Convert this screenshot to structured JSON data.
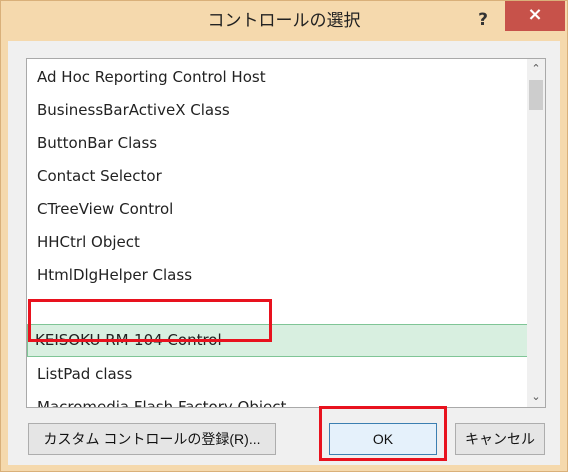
{
  "window": {
    "title": "コントロールの選択",
    "help_label": "?",
    "close_label": "×"
  },
  "list": {
    "items": [
      "Ad Hoc Reporting Control Host",
      "BusinessBarActiveX Class",
      "ButtonBar Class",
      "Contact Selector",
      "CTreeView Control",
      "HHCtrl Object",
      "HtmlDlgHelper Class",
      "KEISOKU RM-104 Control",
      "ListPad class",
      "Macromedia Flash Factory Object"
    ],
    "selected_item": "KEISOKU RM-104 Control"
  },
  "scrollbar": {
    "up_icon": "chevron-up-icon",
    "down_icon": "chevron-down-icon"
  },
  "buttons": {
    "register_label": "カスタム コントロールの登録(R)...",
    "ok_label": "OK",
    "cancel_label": "キャンセル"
  },
  "colors": {
    "frame": "#f5d9ad",
    "close_button": "#c7524a",
    "selection_fill": "#d8efe0",
    "selection_border": "#7fc596",
    "annotation_red": "#e8121e"
  }
}
